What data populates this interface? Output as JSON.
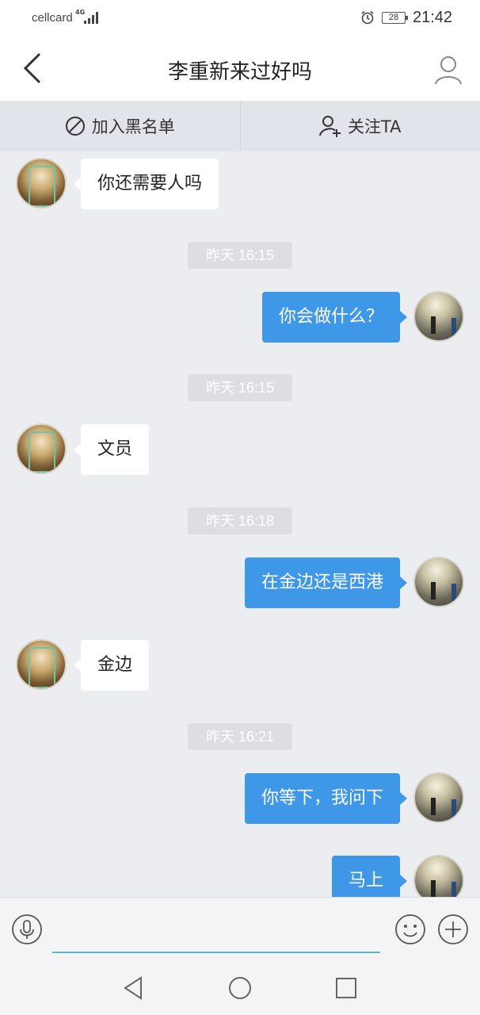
{
  "status_bar": {
    "carrier": "cellcard",
    "network": "4G",
    "battery": "28",
    "time": "21:42"
  },
  "header": {
    "title": "李重新来过好吗",
    "back_icon": "chevron-left-icon",
    "profile_icon": "user-icon"
  },
  "actions": {
    "blacklist_label": "加入黑名单",
    "follow_label": "关注TA"
  },
  "messages": [
    {
      "type": "in",
      "text": "你还需要人吗"
    },
    {
      "type": "time",
      "text": "昨天 16:15"
    },
    {
      "type": "out",
      "text": "你会做什么？"
    },
    {
      "type": "time",
      "text": "昨天 16:15"
    },
    {
      "type": "in",
      "text": "文员"
    },
    {
      "type": "time",
      "text": "昨天 16:18"
    },
    {
      "type": "out",
      "text": "在金边还是西港"
    },
    {
      "type": "in",
      "text": "金边"
    },
    {
      "type": "time",
      "text": "昨天 16:21"
    },
    {
      "type": "out",
      "text": "你等下，我问下"
    },
    {
      "type": "out",
      "text": "马上"
    }
  ],
  "input": {
    "value": "",
    "placeholder": ""
  },
  "colors": {
    "accent": "#3f97e8",
    "background": "#ebedf1"
  }
}
